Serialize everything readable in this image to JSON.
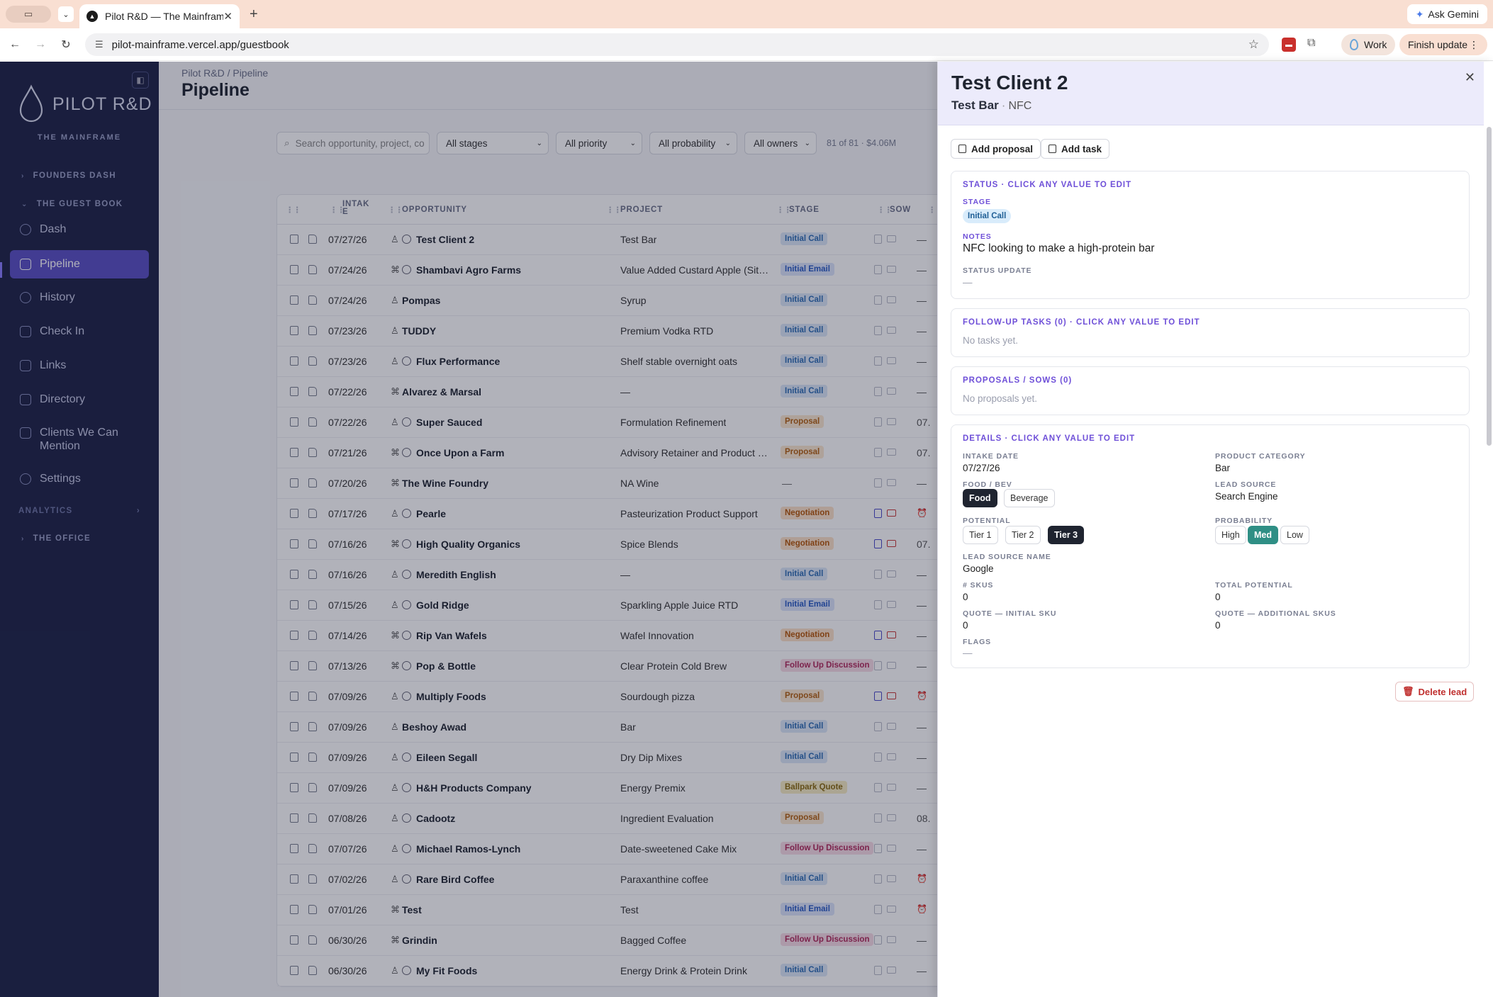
{
  "browser": {
    "tab_title": "Pilot R&D — The Mainframe",
    "url": "pilot-mainframe.vercel.app/guestbook",
    "gemini_label": "Ask Gemini",
    "profile_label": "Work",
    "update_label": "Finish update"
  },
  "sidebar": {
    "logo": "PILOT R&D",
    "tagline": "THE MAINFRAME",
    "sections": {
      "founders": "FOUNDERS DASH",
      "guestbook": "THE GUEST BOOK",
      "analytics": "ANALYTICS",
      "office": "THE OFFICE"
    },
    "items": [
      {
        "label": "Dash",
        "icon": "dashboard-icon"
      },
      {
        "label": "Pipeline",
        "icon": "funnel-icon"
      },
      {
        "label": "History",
        "icon": "clock-icon"
      },
      {
        "label": "Check In",
        "icon": "clipboard-icon"
      },
      {
        "label": "Links",
        "icon": "bookmark-icon"
      },
      {
        "label": "Directory",
        "icon": "book-icon"
      },
      {
        "label": "Clients We Can Mention",
        "icon": "megaphone-icon"
      },
      {
        "label": "Settings",
        "icon": "gear-icon"
      }
    ],
    "active_color": "#5a4fc4",
    "bg_color": "#1e2347"
  },
  "main": {
    "breadcrumb": "Pilot R&D / Pipeline",
    "title": "Pipeline",
    "search_placeholder": "Search opportunity, project, co",
    "filters": {
      "stages": "All stages",
      "priority": "All priority",
      "probability": "All probability",
      "owners": "All owners"
    },
    "count": "81 of 81 · $4.06M",
    "columns": {
      "intake": "INTAK\nE",
      "opportunity": "OPPORTUNITY",
      "project": "PROJECT",
      "stage": "STAGE",
      "sow": "SOW"
    },
    "rows": [
      {
        "date": "07/27/26",
        "opp": "Test Client 2",
        "proj": "Test Bar",
        "stage": "Initial Call",
        "cls": "s-ic",
        "owner": "person",
        "sow": false,
        "tail": "—"
      },
      {
        "date": "07/24/26",
        "opp": "Shambavi Agro Farms",
        "proj": "Value Added Custard Apple (Sita...",
        "stage": "Initial Email",
        "cls": "s-ie",
        "owner": "group",
        "sow": false,
        "tail": "—"
      },
      {
        "date": "07/24/26",
        "opp": "Pompas",
        "proj": "Syrup",
        "stage": "Initial Call",
        "cls": "s-ic",
        "owner": "person",
        "noic": true,
        "sow": false,
        "tail": "—"
      },
      {
        "date": "07/23/26",
        "opp": "TUDDY",
        "proj": "Premium Vodka RTD",
        "stage": "Initial Call",
        "cls": "s-ic",
        "owner": "person",
        "noic": true,
        "sow": false,
        "tail": "—"
      },
      {
        "date": "07/23/26",
        "opp": "Flux Performance",
        "proj": "Shelf stable overnight oats",
        "stage": "Initial Call",
        "cls": "s-ic",
        "owner": "person",
        "sow": false,
        "tail": "—"
      },
      {
        "date": "07/22/26",
        "opp": "Alvarez & Marsal",
        "proj": "—",
        "stage": "Initial Call",
        "cls": "s-ic",
        "owner": "group",
        "noic": true,
        "sow": false,
        "tail": "—"
      },
      {
        "date": "07/22/26",
        "opp": "Super Sauced",
        "proj": "Formulation Refinement",
        "stage": "Proposal",
        "cls": "s-pr",
        "owner": "person",
        "sow": false,
        "tail": "07."
      },
      {
        "date": "07/21/26",
        "opp": "Once Upon a Farm",
        "proj": "Advisory Retainer and Product S...",
        "stage": "Proposal",
        "cls": "s-pr",
        "owner": "group",
        "sow": false,
        "tail": "07."
      },
      {
        "date": "07/20/26",
        "opp": "The Wine Foundry",
        "proj": "NA Wine",
        "stage": "—",
        "cls": "",
        "owner": "group",
        "noic": true,
        "sow": false,
        "tail": "—"
      },
      {
        "date": "07/17/26",
        "opp": "Pearle",
        "proj": "Pasteurization Product Support",
        "stage": "Negotiation",
        "cls": "s-ne",
        "owner": "person",
        "sow": true,
        "tail": "⏰"
      },
      {
        "date": "07/16/26",
        "opp": "High Quality Organics",
        "proj": "Spice Blends",
        "stage": "Negotiation",
        "cls": "s-ne",
        "owner": "group",
        "sow": true,
        "tail": "07."
      },
      {
        "date": "07/16/26",
        "opp": "Meredith English",
        "proj": "—",
        "stage": "Initial Call",
        "cls": "s-ic",
        "owner": "person",
        "sow": false,
        "tail": "—"
      },
      {
        "date": "07/15/26",
        "opp": "Gold Ridge",
        "proj": "Sparkling Apple Juice RTD",
        "stage": "Initial Email",
        "cls": "s-ie",
        "owner": "person",
        "sow": false,
        "tail": "—"
      },
      {
        "date": "07/14/26",
        "opp": "Rip Van Wafels",
        "proj": "Wafel Innovation",
        "stage": "Negotiation",
        "cls": "s-ne",
        "owner": "group",
        "sow": true,
        "tail": "—"
      },
      {
        "date": "07/13/26",
        "opp": "Pop & Bottle",
        "proj": "Clear Protein Cold Brew",
        "stage": "Follow Up Discussion",
        "cls": "s-fu",
        "owner": "group",
        "sow": false,
        "tail": "—"
      },
      {
        "date": "07/09/26",
        "opp": "Multiply Foods",
        "proj": "Sourdough pizza",
        "stage": "Proposal",
        "cls": "s-pr",
        "owner": "person",
        "sow": true,
        "tail": "⏰"
      },
      {
        "date": "07/09/26",
        "opp": "Beshoy Awad",
        "proj": "Bar",
        "stage": "Initial Call",
        "cls": "s-ic",
        "owner": "person",
        "noic": true,
        "sow": false,
        "tail": "—"
      },
      {
        "date": "07/09/26",
        "opp": "Eileen Segall",
        "proj": "Dry Dip Mixes",
        "stage": "Initial Call",
        "cls": "s-ic",
        "owner": "person",
        "sow": false,
        "tail": "—"
      },
      {
        "date": "07/09/26",
        "opp": "H&H Products Company",
        "proj": "Energy Premix",
        "stage": "Ballpark Quote",
        "cls": "s-bq",
        "owner": "person",
        "sow": false,
        "tail": "—"
      },
      {
        "date": "07/08/26",
        "opp": "Cadootz",
        "proj": "Ingredient Evaluation",
        "stage": "Proposal",
        "cls": "s-pr",
        "owner": "person",
        "sow": false,
        "tail": "08."
      },
      {
        "date": "07/07/26",
        "opp": "Michael Ramos-Lynch",
        "proj": "Date-sweetened Cake Mix",
        "stage": "Follow Up Discussion",
        "cls": "s-fu",
        "owner": "person",
        "sow": false,
        "tail": "—"
      },
      {
        "date": "07/02/26",
        "opp": "Rare Bird Coffee",
        "proj": "Paraxanthine coffee",
        "stage": "Initial Call",
        "cls": "s-ic",
        "owner": "person",
        "sow": false,
        "tail": "⏰"
      },
      {
        "date": "07/01/26",
        "opp": "Test",
        "proj": "Test",
        "stage": "Initial Email",
        "cls": "s-ie",
        "owner": "group",
        "noic": true,
        "sow": false,
        "tail": "⏰"
      },
      {
        "date": "06/30/26",
        "opp": "Grindin",
        "proj": "Bagged Coffee",
        "stage": "Follow Up Discussion",
        "cls": "s-fu",
        "owner": "group",
        "noic": true,
        "sow": false,
        "tail": "—"
      },
      {
        "date": "06/30/26",
        "opp": "My Fit Foods",
        "proj": "Energy Drink & Protein Drink",
        "stage": "Initial Call",
        "cls": "s-ic",
        "owner": "person",
        "sow": false,
        "tail": "—"
      }
    ]
  },
  "panel": {
    "title": "Test Client 2",
    "subtitle": "Test Bar",
    "category": "NFC",
    "add_proposal": "Add proposal",
    "add_task": "Add task",
    "status": {
      "header": "STATUS · CLICK ANY VALUE TO EDIT",
      "stage_label": "STAGE",
      "stage_value": "Initial Call",
      "notes_label": "NOTES",
      "notes_value": "NFC looking to make a high-protein bar",
      "update_label": "STATUS UPDATE",
      "update_value": "—"
    },
    "tasks": {
      "header": "FOLLOW-UP TASKS (0) · CLICK ANY VALUE TO EDIT",
      "empty": "No tasks yet."
    },
    "proposals": {
      "header": "PROPOSALS / SOWS (0)",
      "empty": "No proposals yet."
    },
    "details": {
      "header": "DETAILS · CLICK ANY VALUE TO EDIT",
      "intake_label": "INTAKE DATE",
      "intake_value": "07/27/26",
      "category_label": "PRODUCT CATEGORY",
      "category_value": "Bar",
      "foodbev_label": "FOOD / BEV",
      "food": "Food",
      "bev": "Beverage",
      "leadsource_label": "LEAD SOURCE",
      "leadsource_value": "Search Engine",
      "potential_label": "POTENTIAL",
      "tier1": "Tier 1",
      "tier2": "Tier 2",
      "tier3": "Tier 3",
      "probability_label": "PROBABILITY",
      "high": "High",
      "med": "Med",
      "low": "Low",
      "lsname_label": "LEAD SOURCE NAME",
      "lsname_value": "Google",
      "skus_label": "# SKUS",
      "skus_value": "0",
      "total_label": "TOTAL POTENTIAL",
      "total_value": "0",
      "quote_initial_label": "QUOTE — INITIAL SKU",
      "quote_initial_value": "0",
      "quote_add_label": "QUOTE — ADDITIONAL SKUS",
      "quote_add_value": "0",
      "flags_label": "FLAGS",
      "flags_value": "—"
    },
    "delete_label": "Delete lead"
  }
}
